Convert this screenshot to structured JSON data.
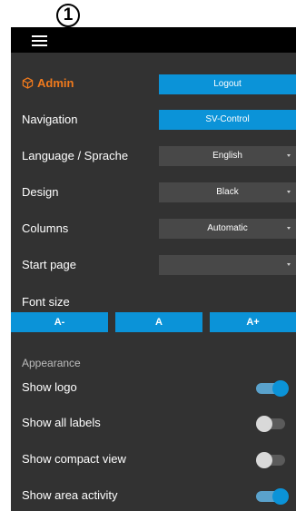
{
  "annotation": {
    "badge": "1"
  },
  "menu": {
    "icon": "hamburger-menu-icon"
  },
  "admin": {
    "label": "Admin",
    "icon": "cube-icon",
    "color": "#f07a1d",
    "logout_label": "Logout"
  },
  "navigation": {
    "label": "Navigation",
    "value": "SV-Control"
  },
  "language": {
    "label": "Language / Sprache",
    "value": "English"
  },
  "design": {
    "label": "Design",
    "value": "Black"
  },
  "columns": {
    "label": "Columns",
    "value": "Automatic"
  },
  "start_page": {
    "label": "Start page",
    "value": ""
  },
  "font_size": {
    "label": "Font size",
    "decrease": "A-",
    "reset": "A",
    "increase": "A+"
  },
  "appearance": {
    "heading": "Appearance",
    "toggles": [
      {
        "label": "Show logo",
        "on": true
      },
      {
        "label": "Show all labels",
        "on": false
      },
      {
        "label": "Show compact view",
        "on": false
      },
      {
        "label": "Show area activity",
        "on": true
      }
    ]
  },
  "colors": {
    "accent": "#0b93d8",
    "panel": "#323232",
    "topbar": "#000000",
    "select": "#484848"
  }
}
